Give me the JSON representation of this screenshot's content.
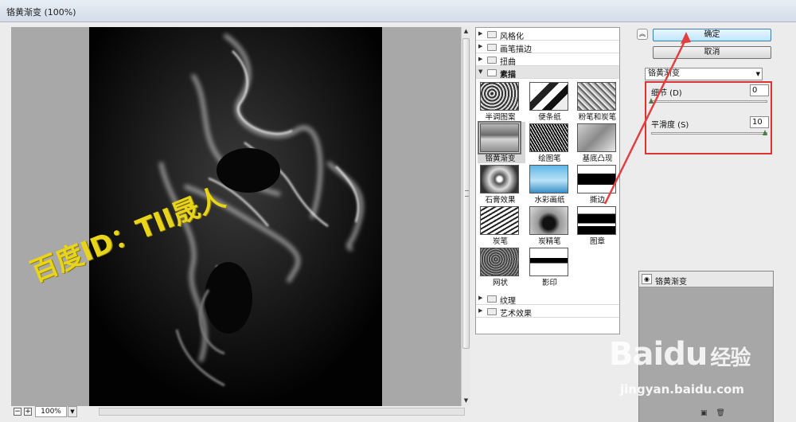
{
  "window": {
    "title": "铬黄渐变 (100%)"
  },
  "preview": {
    "zoom": "100%"
  },
  "gallery": {
    "categories_top": [
      "风格化",
      "画笔描边",
      "扭曲"
    ],
    "open_category": "素描",
    "filters": [
      "半调图案",
      "便条纸",
      "粉笔和炭笔",
      "铬黄渐变",
      "绘图笔",
      "基底凸现",
      "石膏效果",
      "水彩画纸",
      "撕边",
      "炭笔",
      "炭精笔",
      "图章",
      "网状",
      "影印"
    ],
    "selected_filter": "铬黄渐变",
    "categories_bottom": [
      "纹理",
      "艺术效果"
    ]
  },
  "panel": {
    "ok_label": "确定",
    "cancel_label": "取消",
    "filter_select": "铬黄渐变",
    "detail_label": "细节 (D)",
    "detail_value": "0",
    "smooth_label": "平滑度 (S)",
    "smooth_value": "10",
    "detail_level": 0,
    "smooth_level": 1.0,
    "layer_label": "铬黄渐变"
  },
  "overlays": {
    "watermark": "百度ID：TII晟人",
    "baidu_logo": "Baidu",
    "baidu_cn": "经验",
    "baidu_url": "jingyan.baidu.com"
  },
  "colors": {
    "watermark": "#e8d41b",
    "highlight_box": "#dd3333",
    "arrow": "#e04040"
  }
}
